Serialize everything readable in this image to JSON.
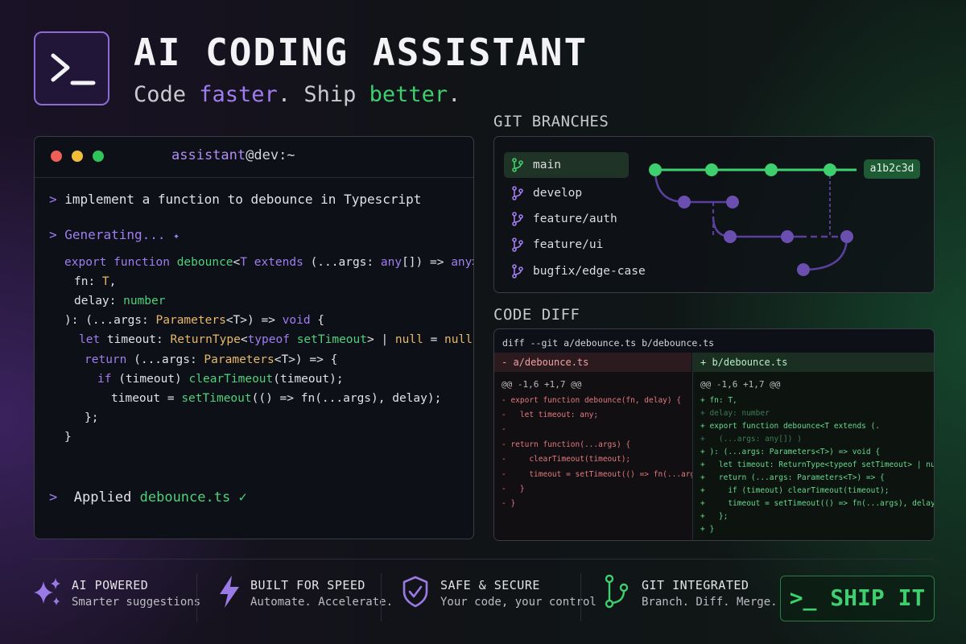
{
  "header": {
    "title": "AI CODING ASSISTANT",
    "tagline": {
      "w1": "Code ",
      "w2": "faster",
      "w3": ". Ship ",
      "w4": "better",
      "w5": "."
    }
  },
  "terminal": {
    "title_user": "assistant",
    "title_host": "@dev:~",
    "prompt_symbol": ">",
    "command": "implement a function to debounce in Typescript",
    "status": "Generating...",
    "applied_label": "Applied ",
    "applied_file": "debounce.ts",
    "check": "✓"
  },
  "git": {
    "section_title": "GIT BRANCHES",
    "branches": [
      {
        "label": "main"
      },
      {
        "label": "develop"
      },
      {
        "label": "feature/auth"
      },
      {
        "label": "feature/ui"
      },
      {
        "label": "bugfix/edge-case"
      }
    ],
    "commit_hash": "a1b2c3d"
  },
  "diff": {
    "section_title": "CODE DIFF",
    "header": "diff --git a/debounce.ts b/debounce.ts",
    "left_file": "- a/debounce.ts",
    "right_file": "+ b/debounce.ts",
    "hunk": "@@ -1,6 +1,7 @@",
    "left_lines": [
      "- export function debounce(fn, delay) {",
      "-   let timeout: any;",
      "-",
      "- return function(...args) {",
      "-     clearTimeout(timeout);",
      "-     timeout = setTimeout(() => fn(...args), delay);",
      "-   }",
      "- }"
    ],
    "right_lines": [
      "+ fn: T,",
      "+ delay: number",
      "+ export function debounce<T extends (.",
      "+   (...args: any[]) )",
      "+ ): (...args: Parameters<T>) => void {",
      "+   let timeout: ReturnType<typeof setTimeout> | null = null;",
      "+   return (...args: Parameters<T>) => {",
      "+     if (timeout) clearTimeout(timeout);",
      "+     timeout = setTimeout(() => fn(...args), delay);",
      "+   };",
      "+ }"
    ]
  },
  "features": [
    {
      "title": "AI POWERED",
      "subtitle": "Smarter suggestions",
      "icon": "sparkles-icon"
    },
    {
      "title": "BUILT FOR SPEED",
      "subtitle": "Automate. Accelerate.",
      "icon": "lightning-icon"
    },
    {
      "title": "SAFE & SECURE",
      "subtitle": "Your code, your control",
      "icon": "shield-check-icon"
    },
    {
      "title": "GIT INTEGRATED",
      "subtitle": "Branch. Diff. Merge.",
      "icon": "git-branch-icon"
    }
  ],
  "cta": {
    "label": ">_ SHIP IT"
  },
  "colors": {
    "purple": "#a07df0",
    "green": "#3ecf6e",
    "background": "#111317"
  }
}
